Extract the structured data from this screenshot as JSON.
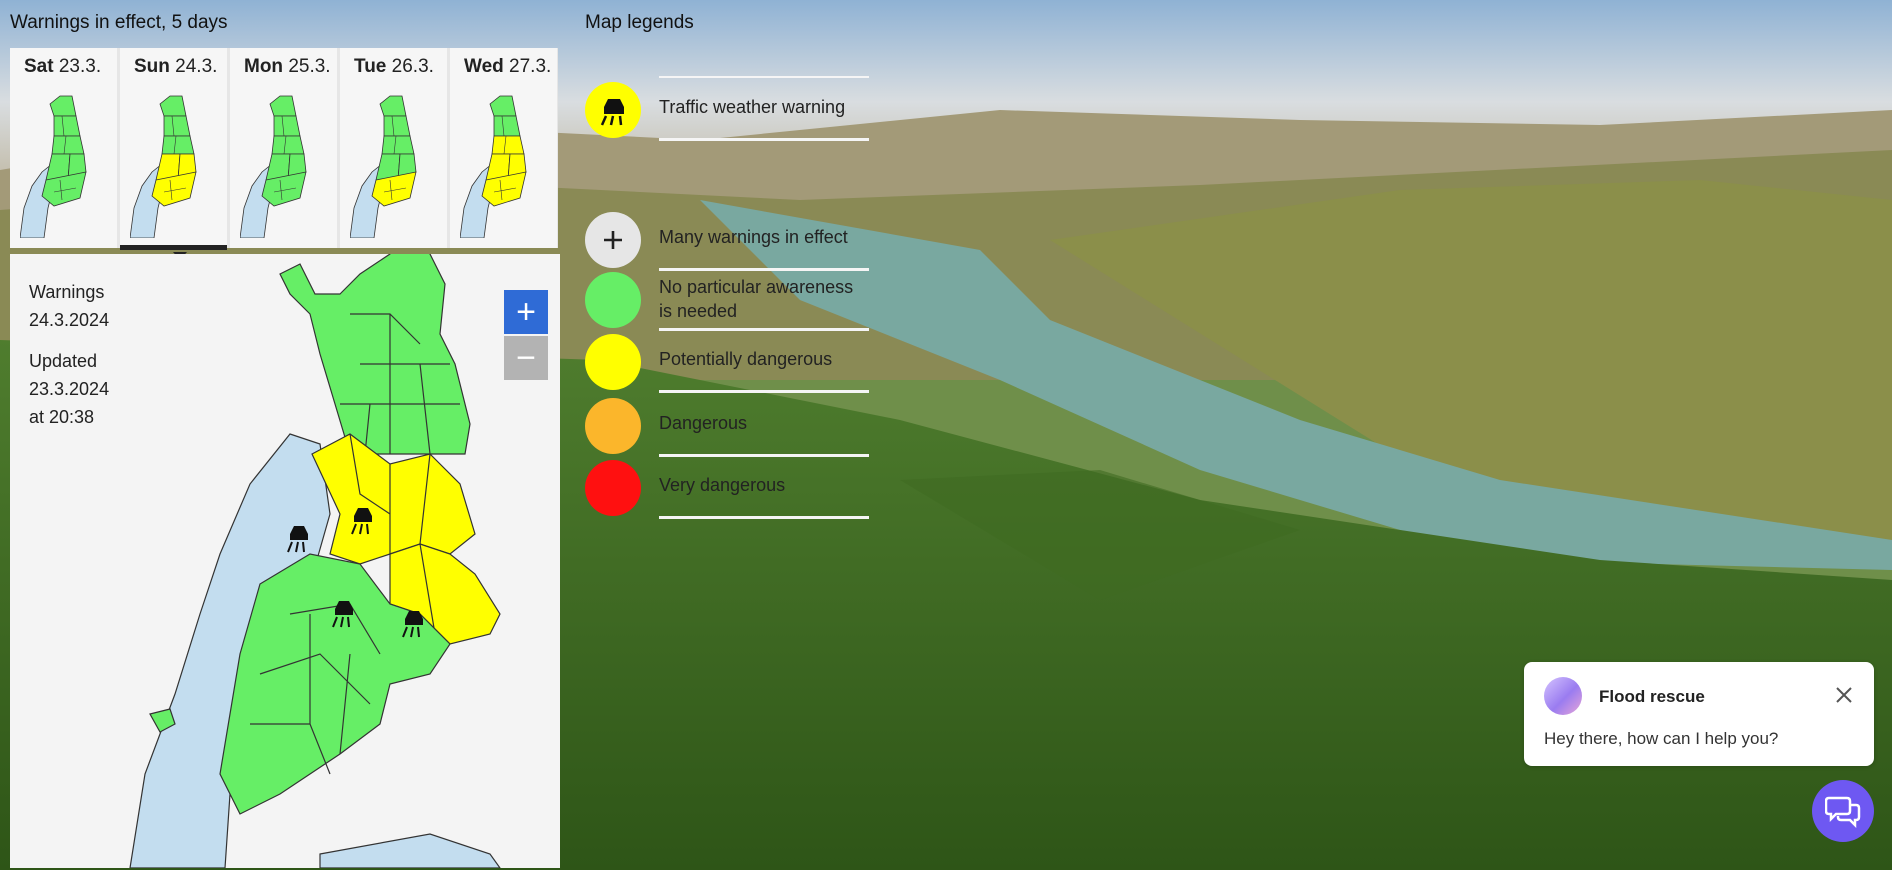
{
  "warnings_panel": {
    "title": "Warnings in effect, 5 days",
    "days": [
      {
        "day": "Sat",
        "date": "23.3.",
        "levels": [
          "green",
          "green",
          "green",
          "green",
          "green",
          "green"
        ]
      },
      {
        "day": "Sun",
        "date": "24.3.",
        "levels": [
          "green",
          "green",
          "green",
          "yellow",
          "yellow",
          "yellow"
        ]
      },
      {
        "day": "Mon",
        "date": "25.3.",
        "levels": [
          "green",
          "green",
          "green",
          "green",
          "green",
          "green"
        ]
      },
      {
        "day": "Tue",
        "date": "26.3.",
        "levels": [
          "green",
          "green",
          "green",
          "green",
          "green",
          "yellow"
        ]
      },
      {
        "day": "Wed",
        "date": "27.3.",
        "levels": [
          "green",
          "green",
          "yellow",
          "yellow",
          "yellow",
          "yellow"
        ]
      }
    ],
    "selected_day_index": 1,
    "warnings_label": "Warnings",
    "warnings_date": "24.3.2024",
    "updated_label": "Updated",
    "updated_date": "23.3.2024",
    "updated_time": "at 20:38",
    "zoom_in": "+",
    "zoom_out": "−"
  },
  "legend": {
    "title": "Map legends",
    "items": [
      {
        "label": "Traffic weather warning",
        "icon": "skid-car-icon",
        "color": "#ffff00"
      },
      {
        "label": "Many warnings in effect",
        "icon": "plus-icon",
        "color": "#e6e6e6"
      },
      {
        "label": "No particular awareness is needed",
        "color": "#66ee66"
      },
      {
        "label": "Potentially dangerous",
        "color": "#ffff00"
      },
      {
        "label": "Dangerous",
        "color": "#fbb62b"
      },
      {
        "label": "Very dangerous",
        "color": "#ff1010"
      }
    ]
  },
  "chat": {
    "title": "Flood rescue",
    "message": "Hey there, how can I help you?",
    "accent": "#6e58f2"
  },
  "colors": {
    "green": "#66ee66",
    "yellow": "#ffff00",
    "sea": "#c3ddef",
    "zoom_blue": "#2f6bd6"
  }
}
